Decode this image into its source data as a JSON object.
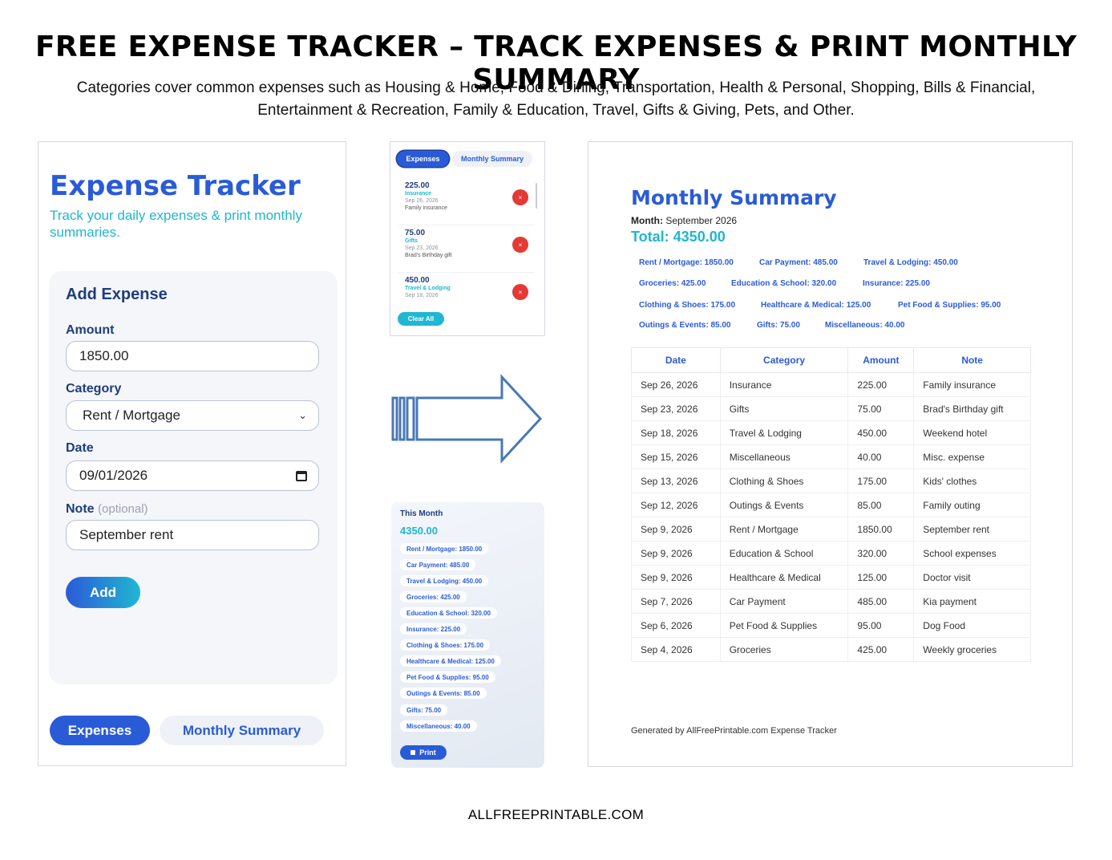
{
  "header": {
    "title": "FREE EXPENSE TRACKER – TRACK EXPENSES & PRINT MONTHLY SUMMARY",
    "subtitle": "Categories cover common expenses such as Housing & Home, Food & Dining, Transportation, Health & Personal, Shopping, Bills & Financial, Entertainment & Recreation, Family & Education, Travel, Gifts & Giving, Pets, and Other."
  },
  "app": {
    "title": "Expense Tracker",
    "tagline": "Track your daily expenses & print monthly summaries.",
    "form": {
      "title": "Add Expense",
      "amount_label": "Amount",
      "amount_value": "1850.00",
      "category_label": "Category",
      "category_value": "Rent / Mortgage",
      "date_label": "Date",
      "date_value": "09/01/2026",
      "note_label": "Note",
      "note_optional": "(optional)",
      "note_value": "September rent",
      "add_button": "Add"
    },
    "tabs": {
      "expenses": "Expenses",
      "summary": "Monthly Summary"
    }
  },
  "mini_list": {
    "tabs": {
      "expenses": "Expenses",
      "summary": "Monthly Summary"
    },
    "items": [
      {
        "amount": "225.00",
        "category": "Insurance",
        "date": "Sep 26, 2026",
        "note": "Family insurance"
      },
      {
        "amount": "75.00",
        "category": "Gifts",
        "date": "Sep 23, 2026",
        "note": "Brad's Birthday gift"
      },
      {
        "amount": "450.00",
        "category": "Travel & Lodging",
        "date": "Sep 18, 2026",
        "note": ""
      }
    ],
    "delete_glyph": "×",
    "clear_all": "Clear All"
  },
  "month_panel": {
    "title": "This Month",
    "total": "4350.00",
    "chips": [
      "Rent / Mortgage: 1850.00",
      "Car Payment: 485.00",
      "Travel & Lodging: 450.00",
      "Groceries: 425.00",
      "Education & School: 320.00",
      "Insurance: 225.00",
      "Clothing & Shoes: 175.00",
      "Healthcare & Medical: 125.00",
      "Pet Food & Supplies: 95.00",
      "Outings & Events: 85.00",
      "Gifts: 75.00",
      "Miscellaneous: 40.00"
    ],
    "print_button": "Print"
  },
  "summary": {
    "title": "Monthly Summary",
    "month_label": "Month:",
    "month_value": "September 2026",
    "total": "Total: 4350.00",
    "category_rows": [
      [
        "Rent / Mortgage: 1850.00",
        "Car Payment: 485.00",
        "Travel & Lodging: 450.00"
      ],
      [
        "Groceries: 425.00",
        "Education & School: 320.00",
        "Insurance: 225.00"
      ],
      [
        "Clothing & Shoes: 175.00",
        "Healthcare & Medical: 125.00",
        "Pet Food & Supplies: 95.00"
      ],
      [
        "Outings & Events: 85.00",
        "Gifts: 75.00",
        "Miscellaneous: 40.00"
      ]
    ],
    "columns": [
      "Date",
      "Category",
      "Amount",
      "Note"
    ],
    "rows": [
      [
        "Sep 26, 2026",
        "Insurance",
        "225.00",
        "Family insurance"
      ],
      [
        "Sep 23, 2026",
        "Gifts",
        "75.00",
        "Brad's Birthday gift"
      ],
      [
        "Sep 18, 2026",
        "Travel & Lodging",
        "450.00",
        "Weekend hotel"
      ],
      [
        "Sep 15, 2026",
        "Miscellaneous",
        "40.00",
        "Misc. expense"
      ],
      [
        "Sep 13, 2026",
        "Clothing & Shoes",
        "175.00",
        "Kids' clothes"
      ],
      [
        "Sep 12, 2026",
        "Outings & Events",
        "85.00",
        "Family outing"
      ],
      [
        "Sep 9, 2026",
        "Rent / Mortgage",
        "1850.00",
        "September rent"
      ],
      [
        "Sep 9, 2026",
        "Education & School",
        "320.00",
        "School expenses"
      ],
      [
        "Sep 9, 2026",
        "Healthcare & Medical",
        "125.00",
        "Doctor visit"
      ],
      [
        "Sep 7, 2026",
        "Car Payment",
        "485.00",
        "Kia payment"
      ],
      [
        "Sep 6, 2026",
        "Pet Food & Supplies",
        "95.00",
        "Dog Food"
      ],
      [
        "Sep 4, 2026",
        "Groceries",
        "425.00",
        "Weekly groceries"
      ]
    ],
    "footer": "Generated by AllFreePrintable.com Expense Tracker"
  },
  "site": {
    "brand": "ALLFREEPRINTABLE.COM"
  },
  "colors": {
    "primary": "#2a5bd7",
    "accent": "#1fb6cf",
    "danger": "#e53935",
    "arrow": "#4a78b5"
  }
}
